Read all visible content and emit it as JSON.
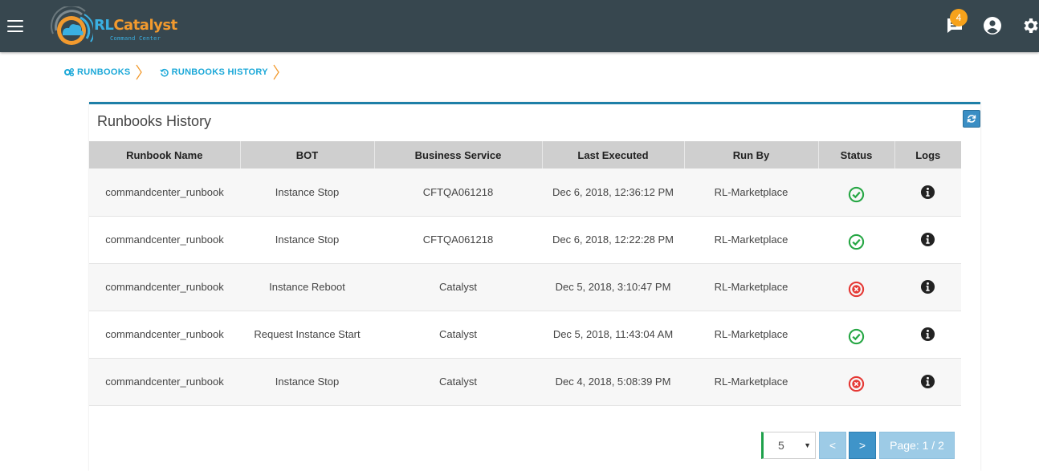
{
  "app": {
    "logo_main_rl": "RL",
    "logo_main_rest": "Catalyst",
    "logo_sub": "Command Center",
    "notification_count": "4",
    "accent_color": "#1ba8d8",
    "header_color": "#37474f"
  },
  "breadcrumb": [
    {
      "label": "RUNBOOKS",
      "icon": "cogs-icon"
    },
    {
      "label": "RUNBOOKS HISTORY",
      "icon": "history-icon"
    }
  ],
  "panel": {
    "title": "Runbooks History"
  },
  "table": {
    "columns": [
      "Runbook Name",
      "BOT",
      "Business Service",
      "Last Executed",
      "Run By",
      "Status",
      "Logs"
    ],
    "rows": [
      {
        "runbook": "commandcenter_runbook",
        "bot": "Instance Stop",
        "service": "CFTQA061218",
        "executed": "Dec 6, 2018, 12:36:12 PM",
        "run_by": "RL-Marketplace",
        "status": "success"
      },
      {
        "runbook": "commandcenter_runbook",
        "bot": "Instance Stop",
        "service": "CFTQA061218",
        "executed": "Dec 6, 2018, 12:22:28 PM",
        "run_by": "RL-Marketplace",
        "status": "success"
      },
      {
        "runbook": "commandcenter_runbook",
        "bot": "Instance Reboot",
        "service": "Catalyst",
        "executed": "Dec 5, 2018, 3:10:47 PM",
        "run_by": "RL-Marketplace",
        "status": "failed"
      },
      {
        "runbook": "commandcenter_runbook",
        "bot": "Request Instance Start",
        "service": "Catalyst",
        "executed": "Dec 5, 2018, 11:43:04 AM",
        "run_by": "RL-Marketplace",
        "status": "success"
      },
      {
        "runbook": "commandcenter_runbook",
        "bot": "Instance Stop",
        "service": "Catalyst",
        "executed": "Dec 4, 2018, 5:08:39 PM",
        "run_by": "RL-Marketplace",
        "status": "failed"
      }
    ]
  },
  "pagination": {
    "page_size": "5",
    "prev_label": "<",
    "next_label": ">",
    "page_info": "Page: 1 / 2"
  },
  "colors": {
    "success": "#27a745",
    "failed": "#e53935"
  }
}
